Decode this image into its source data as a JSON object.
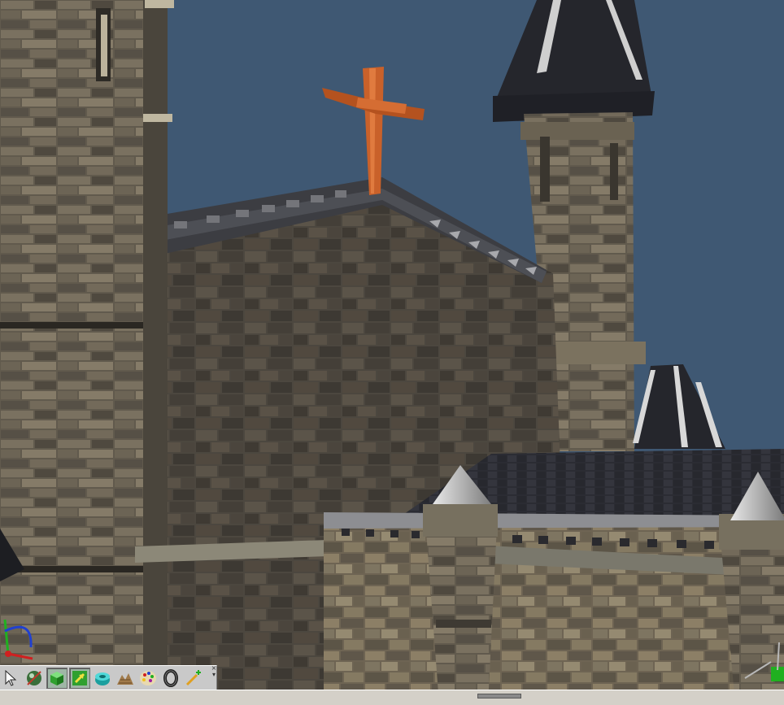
{
  "app": {
    "window_title": ""
  },
  "viewport": {
    "sky_color": "#3f5873",
    "stone_color": "#5f584d",
    "roof_color": "#2b2b30",
    "cross_color": "#c9612a"
  },
  "toolbar": {
    "tools": [
      {
        "name": "select",
        "icon": "arrow-cursor-icon",
        "active": false
      },
      {
        "name": "orbit",
        "icon": "sphere-tool-icon",
        "active": false
      },
      {
        "name": "box",
        "icon": "green-box-icon",
        "active": true
      },
      {
        "name": "transform",
        "icon": "move-arrow-icon",
        "active": true
      },
      {
        "name": "cylinder",
        "icon": "cylinder-icon",
        "active": false
      },
      {
        "name": "terrain",
        "icon": "terrain-icon",
        "active": false
      },
      {
        "name": "palette",
        "icon": "palette-icon",
        "active": false
      },
      {
        "name": "ring",
        "icon": "torus-icon",
        "active": false
      },
      {
        "name": "wand",
        "icon": "magic-wand-icon",
        "active": false
      }
    ]
  },
  "axes": {
    "x_color": "#d02020",
    "y_color": "#20b020",
    "z_color": "#2040d0"
  }
}
